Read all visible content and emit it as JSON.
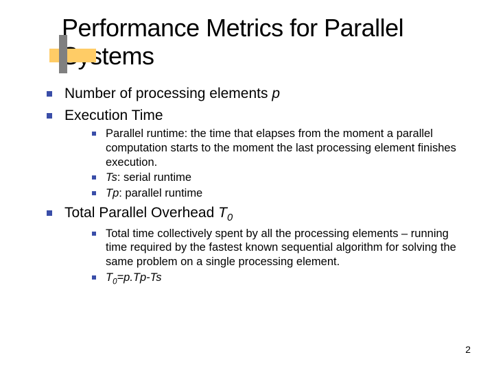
{
  "title": "Performance Metrics for Parallel Systems",
  "bullets": {
    "b1_pre": "Number of processing elements ",
    "b1_var": "p",
    "b2": "Execution Time",
    "b2a": "Parallel runtime: the time that elapses from the moment a parallel computation starts to the moment the last processing element finishes execution.",
    "b2b_var": "Ts",
    "b2b_rest": ": serial runtime",
    "b2c_var": "Tp",
    "b2c_rest": ": parallel runtime",
    "b3_pre": "Total Parallel Overhead ",
    "b3_var": "T",
    "b3_sub": "0",
    "b3a": "Total time collectively spent by all the processing elements – running time required by the fastest known sequential algorithm for solving the same problem on a single processing element.",
    "b3b_var1": "T",
    "b3b_sub": "0",
    "b3b_eq": "=p.Tp-Ts"
  },
  "page": "2"
}
